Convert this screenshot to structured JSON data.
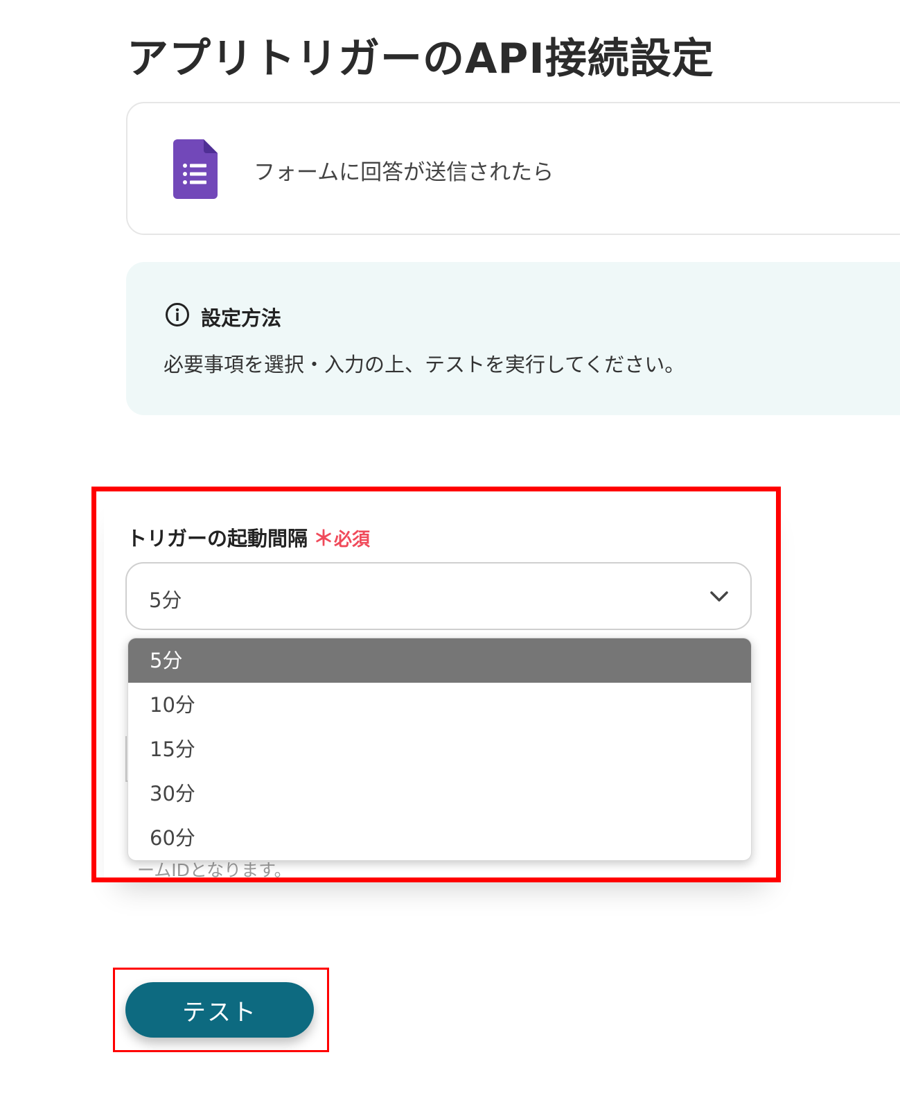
{
  "page": {
    "title": "アプリトリガーのAPI接続設定"
  },
  "trigger": {
    "icon": "google-forms-icon",
    "label": "フォームに回答が送信されたら",
    "icon_color": "#7248b9"
  },
  "info": {
    "icon": "info-circle-icon",
    "title": "設定方法",
    "text": "必要事項を選択・入力の上、テストを実行してください。"
  },
  "interval_field": {
    "label": "トリガーの起動間隔",
    "required_mark": "＊",
    "required_text": "必須",
    "selected_value": "5分",
    "chevron_icon": "chevron-down-icon",
    "options": [
      {
        "label": "5分",
        "selected": true
      },
      {
        "label": "10分",
        "selected": false
      },
      {
        "label": "15分",
        "selected": false
      },
      {
        "label": "30分",
        "selected": false
      },
      {
        "label": "60分",
        "selected": false
      }
    ]
  },
  "helper": {
    "text": "ームIDとなります。"
  },
  "actions": {
    "test_label": "テスト"
  },
  "colors": {
    "accent": "#0d6a80",
    "required": "#f04a5a",
    "highlight": "#ff0000",
    "info_background": "#eff8f8"
  }
}
